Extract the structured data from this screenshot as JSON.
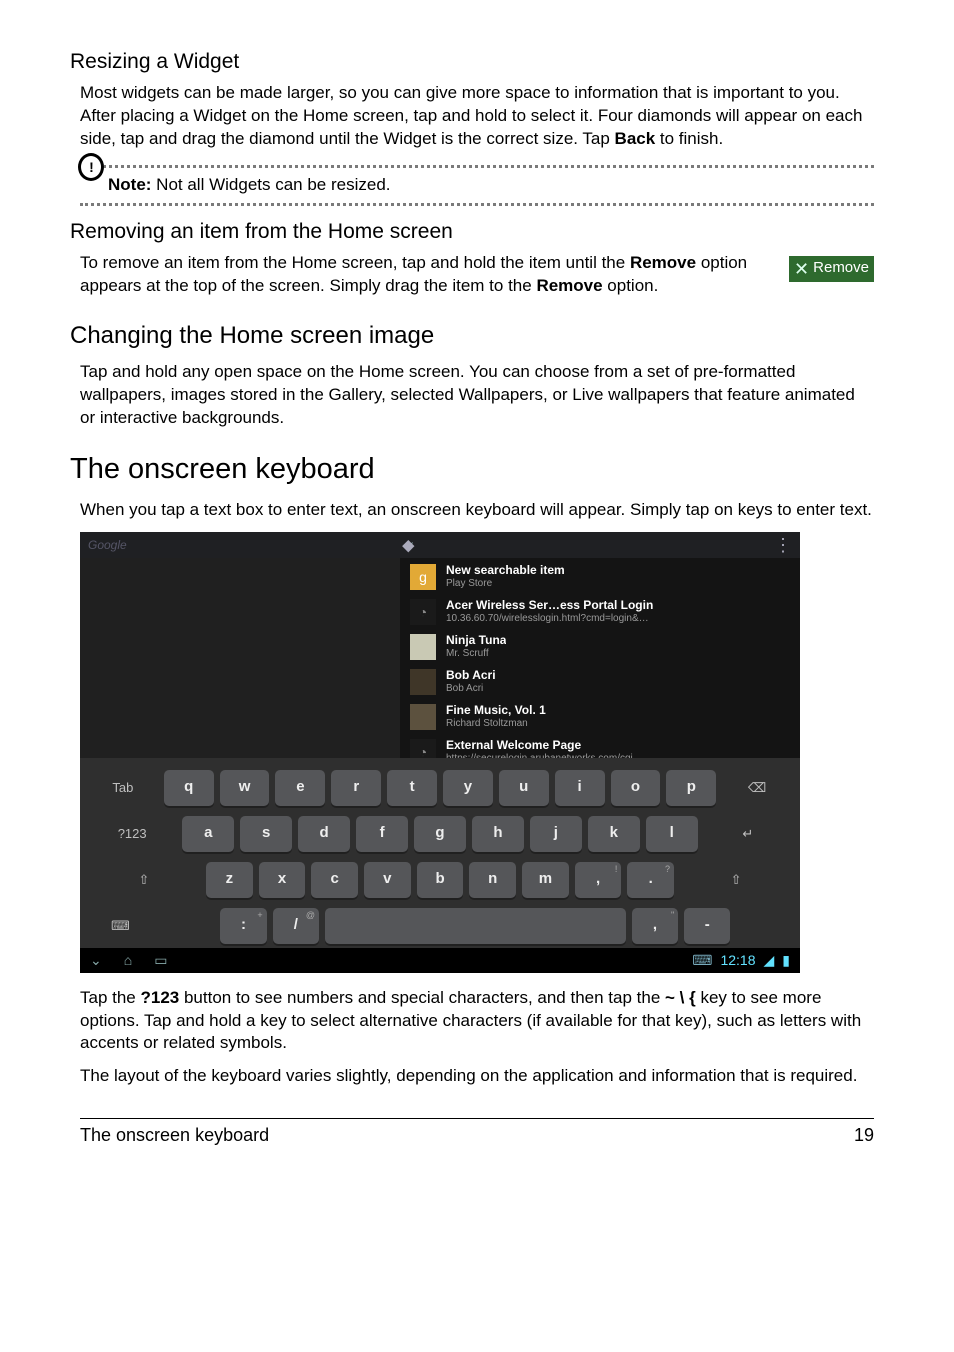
{
  "sections": {
    "resizing": {
      "heading": "Resizing a Widget",
      "body": "Most widgets can be made larger, so you can give more space to information that is important to you. After placing a Widget on the Home screen, tap and hold to select it. Four diamonds will appear on each side, tap and drag the diamond until the Widget is the correct size. Tap ",
      "body_bold": "Back",
      "body_tail": " to finish."
    },
    "note": {
      "label": "Note:",
      "text": " Not all Widgets can be resized."
    },
    "removing": {
      "heading": "Removing an item from the Home screen",
      "body_a": "To remove an item from the Home screen, tap and hold the item until the ",
      "body_b": "Remove",
      "body_c": " option appears at the top of the screen. Simply drag the item to the ",
      "body_d": "Remove",
      "body_e": " option.",
      "remove_btn": "Remove"
    },
    "changing": {
      "heading": "Changing the Home screen image",
      "body": "Tap and hold any open space on the Home screen. You can choose from a set of pre-formatted wallpapers, images stored in the Gallery, selected Wallpapers, or Live wallpapers that feature animated or interactive backgrounds."
    },
    "keyboard": {
      "heading": "The onscreen keyboard",
      "intro": "When you tap a text box to enter text, an onscreen keyboard will appear. Simply tap on keys to enter text.",
      "para2_a": "Tap the ",
      "para2_b": "?123",
      "para2_c": " button to see numbers and special characters, and then tap the ",
      "para2_d": "~ \\ {",
      "para2_e": " key to see more options. Tap and hold a key to select alternative characters (if available for that key), such as letters with accents or related symbols.",
      "para3": "The layout of the keyboard varies slightly, depending on the application and information that is required."
    }
  },
  "screenshot": {
    "search_hint": "Google",
    "suggestions": [
      {
        "icon": "g",
        "icon_class": "g",
        "title": "New searchable item",
        "sub": "Play Store"
      },
      {
        "icon": "◔",
        "icon_class": "clock",
        "title": "Acer Wireless Ser…ess Portal Login",
        "sub": "10.36.60.70/wirelesslogin.html?cmd=login&…"
      },
      {
        "icon": " ",
        "icon_class": "album1",
        "title": "Ninja Tuna",
        "sub": "Mr. Scruff"
      },
      {
        "icon": " ",
        "icon_class": "album2",
        "title": "Bob Acri",
        "sub": "Bob Acri"
      },
      {
        "icon": " ",
        "icon_class": "album3",
        "title": "Fine Music, Vol. 1",
        "sub": "Richard Stoltzman"
      },
      {
        "icon": "◔",
        "icon_class": "clock",
        "title": "External Welcome Page",
        "sub": "https://securelogin.arubanetworks.com/cgi…"
      }
    ],
    "rows": {
      "r1_left": "Tab",
      "r1": [
        "q",
        "w",
        "e",
        "r",
        "t",
        "y",
        "u",
        "i",
        "o",
        "p"
      ],
      "r1_right": "⌫",
      "r2_left": "?123",
      "r2": [
        "a",
        "s",
        "d",
        "f",
        "g",
        "h",
        "j",
        "k",
        "l"
      ],
      "r2_right": "↵",
      "r3_left": "⇧",
      "r3": [
        "z",
        "x",
        "c",
        "v",
        "b",
        "n",
        "m",
        ",",
        "."
      ],
      "r3_right": "⇧",
      "r4_left": "⌨",
      "r4_a": ":",
      "r4_a_alt": "+",
      "r4_b": "/",
      "r4_b_alt": "@",
      "r4_c": ",",
      "r4_c_alt": "\"",
      "r4_d": "-",
      "r3_alt1": "!",
      "r3_alt2": "?"
    },
    "status_time": "12:18"
  },
  "footer": {
    "left": "The onscreen keyboard",
    "right": "19"
  }
}
